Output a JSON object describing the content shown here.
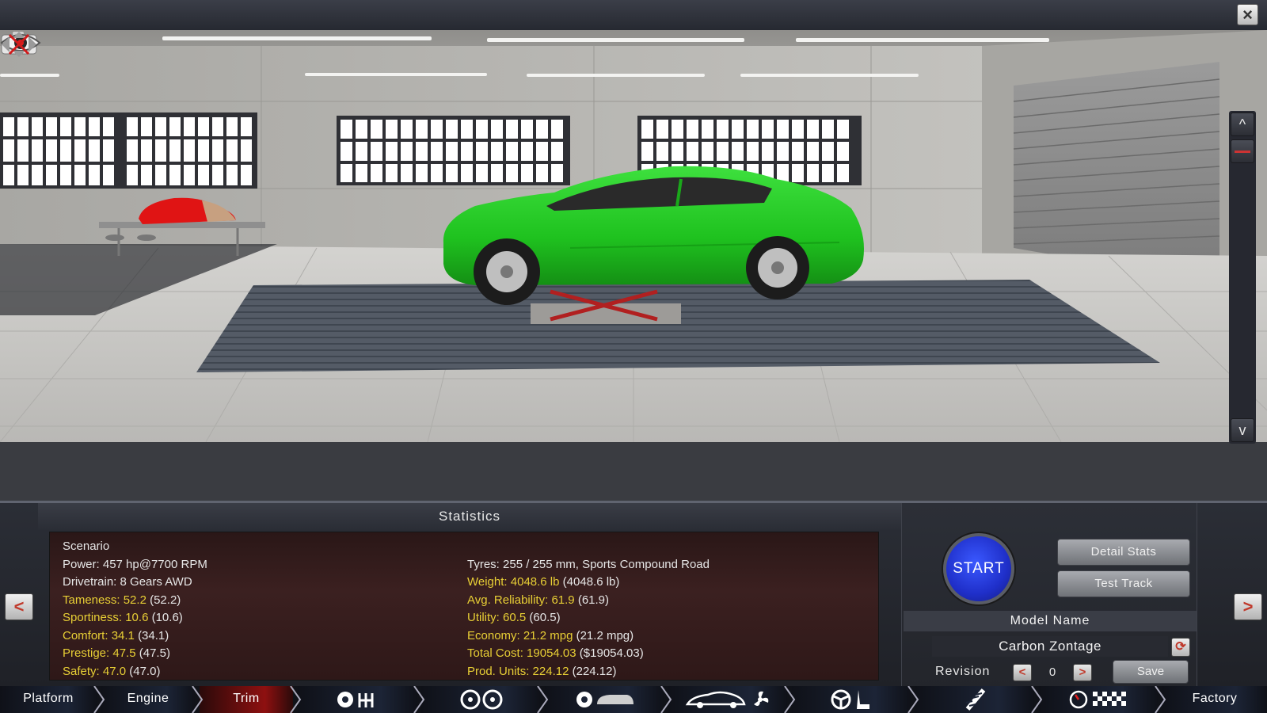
{
  "window": {
    "close_label": "×"
  },
  "scene_controls": {
    "icons": [
      "camera-icon",
      "eye-icon",
      "reset-view-icon"
    ],
    "scroll_up": "^",
    "scroll_down": "v"
  },
  "statistics": {
    "title": "Statistics",
    "left": [
      {
        "label": "Scenario",
        "value": "",
        "base": "",
        "highlight": false
      },
      {
        "label": "Power:",
        "value": "457 hp@7700 RPM",
        "base": "",
        "highlight": false
      },
      {
        "label": "Drivetrain:",
        "value": "8 Gears AWD",
        "base": "",
        "highlight": false
      },
      {
        "label": "Tameness:",
        "value": "52.2",
        "base": "(52.2)",
        "highlight": true
      },
      {
        "label": "Sportiness:",
        "value": "10.6",
        "base": "(10.6)",
        "highlight": true
      },
      {
        "label": "Comfort:",
        "value": "34.1",
        "base": "(34.1)",
        "highlight": true
      },
      {
        "label": "Prestige:",
        "value": "47.5",
        "base": "(47.5)",
        "highlight": true
      },
      {
        "label": "Safety:",
        "value": "47.0",
        "base": "(47.0)",
        "highlight": true
      }
    ],
    "right": [
      {
        "label": "",
        "value": "",
        "base": "",
        "highlight": false
      },
      {
        "label": "Tyres:",
        "value": "255 / 255 mm, Sports Compound Road",
        "base": "",
        "highlight": false
      },
      {
        "label": "Weight:",
        "value": "4048.6 lb",
        "base": "(4048.6 lb)",
        "highlight": true
      },
      {
        "label": "Avg. Reliability:",
        "value": "61.9",
        "base": "(61.9)",
        "highlight": true
      },
      {
        "label": "Utility:",
        "value": "60.5",
        "base": "(60.5)",
        "highlight": true
      },
      {
        "label": "Economy:",
        "value": "21.2 mpg",
        "base": "(21.2 mpg)",
        "highlight": true
      },
      {
        "label": "Total Cost:",
        "value": "19054.03",
        "base": "($19054.03)",
        "highlight": true
      },
      {
        "label": "Prod. Units:",
        "value": "224.12",
        "base": "(224.12)",
        "highlight": true
      }
    ]
  },
  "actions": {
    "start_label": "START",
    "detail_stats_label": "Detail Stats",
    "test_track_label": "Test Track",
    "model_name_label": "Model Name",
    "model_name_value": "Carbon Zontage",
    "revision_label": "Revision",
    "revision_value": "0",
    "rev_prev": "<",
    "rev_next": ">",
    "save_label": "Save"
  },
  "side_nav": {
    "prev": "<",
    "next": ">"
  },
  "navbar": {
    "tabs": [
      {
        "label": "Platform",
        "active": false
      },
      {
        "label": "Engine",
        "active": false
      },
      {
        "label": "Trim",
        "active": true
      },
      {
        "label": "Factory",
        "active": false
      }
    ],
    "icon_steps": [
      "gearbox-icon",
      "wheels-icon",
      "body-icon",
      "aero-icon",
      "interior-icon",
      "suspension-icon",
      "testing-icon"
    ]
  },
  "colors": {
    "highlight": "#e8cf35",
    "active_tab": "#8e1010",
    "start_button": "#2a3ee6",
    "car_body": "#1fc21f"
  }
}
